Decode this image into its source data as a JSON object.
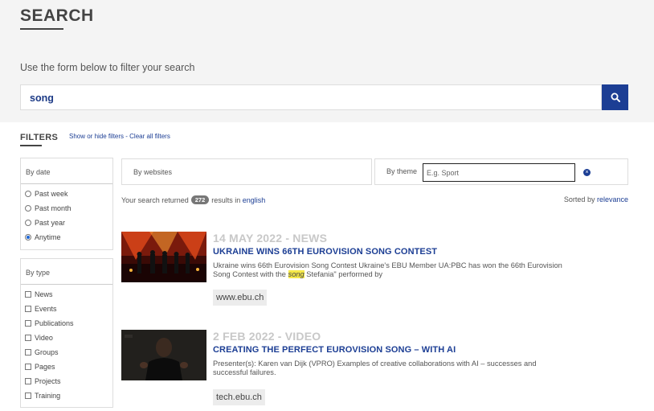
{
  "page": {
    "title": "SEARCH",
    "intro": "Use the form below to filter your search"
  },
  "search": {
    "query": "song",
    "button_icon": "search-icon"
  },
  "filters": {
    "label": "FILTERS",
    "show_hide": "Show or hide filters",
    "separator": " - ",
    "clear_all": "Clear all filters",
    "by_date": {
      "label": "By date",
      "options": [
        "Past week",
        "Past month",
        "Past year",
        "Anytime"
      ],
      "selected": "Anytime"
    },
    "by_type": {
      "label": "By type",
      "options": [
        "News",
        "Events",
        "Publications",
        "Video",
        "Groups",
        "Pages",
        "Projects",
        "Training"
      ]
    },
    "by_websites": {
      "label": "By websites"
    },
    "by_theme": {
      "label": "By theme",
      "placeholder": "E.g. Sport"
    }
  },
  "summary": {
    "prefix": "Your search returned",
    "count": "272",
    "middle": "results in",
    "language": "english",
    "sorted_prefix": "Sorted by",
    "sorted_by": "relevance"
  },
  "results": [
    {
      "meta": "14 MAY 2022 - NEWS",
      "title": "UKRAINE WINS 66TH EUROVISION SONG CONTEST",
      "snippet_before": "Ukraine wins 66th Eurovision Song Contest Ukraine's EBU Member UA:PBC has won the 66th Eurovision Song Contest with the ",
      "snippet_highlight": "song",
      "snippet_after": " Stefania\" performed by",
      "site": "www.ebu.ch"
    },
    {
      "meta": "2 FEB 2022 - VIDEO",
      "title": "CREATING THE PERFECT EUROVISION SONG – WITH AI",
      "snippet_before": "Presenter(s): Karen van Dijk (VPRO) Examples of creative collaborations with AI – successes and successful failures.",
      "snippet_highlight": "",
      "snippet_after": "",
      "site": "tech.ebu.ch"
    }
  ],
  "colors": {
    "brand_blue": "#1c3e94",
    "highlight": "#f5e94a",
    "meta_gray": "#c8c8c8"
  }
}
